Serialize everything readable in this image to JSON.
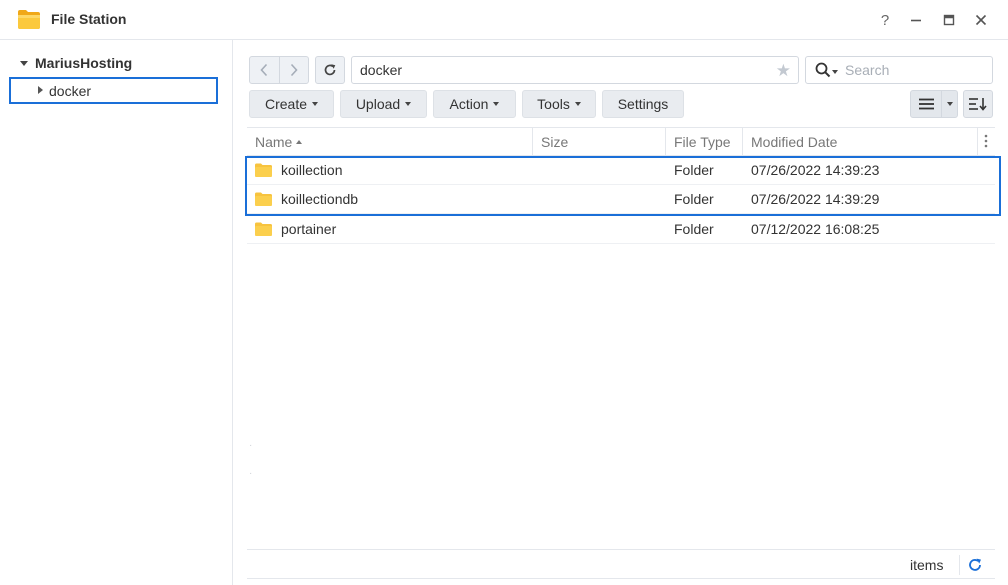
{
  "window": {
    "title": "File Station",
    "help_label": "?",
    "minimize_label": "—",
    "maximize_label": "",
    "close_label": "✕"
  },
  "sidebar": {
    "root_label": "MariusHosting",
    "items": [
      {
        "label": "docker",
        "selected": true
      }
    ]
  },
  "toolbar": {
    "path_value": "docker",
    "search_placeholder": "Search",
    "buttons": {
      "create": "Create",
      "upload": "Upload",
      "action": "Action",
      "tools": "Tools",
      "settings": "Settings"
    }
  },
  "grid": {
    "columns": {
      "name": "Name",
      "size": "Size",
      "file_type": "File Type",
      "modified_date": "Modified Date"
    },
    "rows": [
      {
        "name": "koillection",
        "size": "",
        "type": "Folder",
        "modified": "07/26/2022 14:39:23"
      },
      {
        "name": "koillectiondb",
        "size": "",
        "type": "Folder",
        "modified": "07/26/2022 14:39:29"
      },
      {
        "name": "portainer",
        "size": "",
        "type": "Folder",
        "modified": "07/12/2022 16:08:25"
      }
    ]
  },
  "footer": {
    "items_label": "items"
  },
  "colors": {
    "accent": "#1a6fd8",
    "folder": "#f7c33f"
  },
  "icons": [
    "folder-app-icon",
    "help-icon",
    "minimize-icon",
    "maximize-icon",
    "close-icon",
    "back-icon",
    "forward-icon",
    "refresh-icon",
    "star-icon",
    "search-icon",
    "list-view-icon",
    "sort-icon",
    "folder-icon",
    "column-menu-icon"
  ]
}
